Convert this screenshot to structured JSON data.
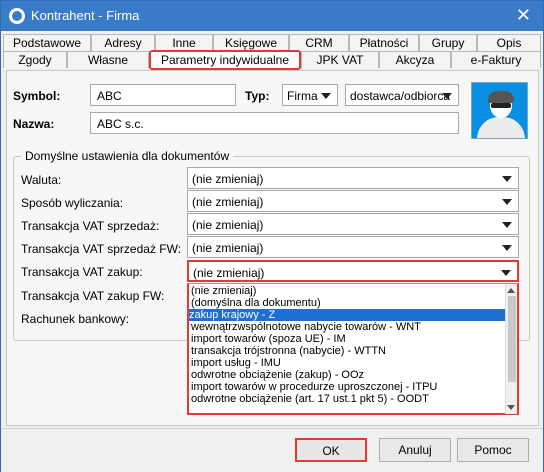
{
  "window": {
    "title": "Kontrahent - Firma"
  },
  "tabs": {
    "row1": [
      "Podstawowe",
      "Adresy",
      "Inne",
      "Księgowe",
      "CRM",
      "Płatności",
      "Grupy",
      "Opis"
    ],
    "row2": [
      "Zgody",
      "Własne",
      "Parametry indywidualne",
      "JPK VAT",
      "Akcyza",
      "e-Faktury"
    ],
    "active": "Parametry indywidualne"
  },
  "header": {
    "symbol_label": "Symbol:",
    "symbol_value": "ABC",
    "typ_label": "Typ:",
    "typ_value": "Firma",
    "role_value": "dostawca/odbiorca",
    "nazwa_label": "Nazwa:",
    "nazwa_value": "ABC s.c."
  },
  "defaults": {
    "group_title": "Domyślne ustawienia dla dokumentów",
    "labels": [
      "Waluta:",
      "Sposób wyliczania:",
      "Transakcja VAT sprzedaż:",
      "Transakcja VAT sprzedaż FW:",
      "Transakcja VAT zakup:",
      "Transakcja VAT zakup FW:",
      "Rachunek bankowy:"
    ],
    "combo_value": "(nie zmieniaj)"
  },
  "dropdown": {
    "options": [
      "(nie zmieniaj)",
      "(domyślna dla dokumentu)",
      "zakup krajowy - Z",
      "wewnątrzwspólnotowe nabycie towarów - WNT",
      "import towarów (spoza UE) - IM",
      "transakcja trójstronna (nabycie) - WTTN",
      "import usług - IMU",
      "odwrotne obciążenie (zakup) - OOz",
      "import towarów w procedurze uproszczonej - ITPU",
      "odwrotne obciążenie (art. 17 ust.1 pkt 5) - OODT"
    ],
    "selected_index": 2
  },
  "buttons": {
    "ok": "OK",
    "cancel": "Anuluj",
    "help": "Pomoc"
  },
  "colors": {
    "titlebar": "#3a7bc8",
    "highlight": "#e53935",
    "selection": "#1d6fd0"
  }
}
